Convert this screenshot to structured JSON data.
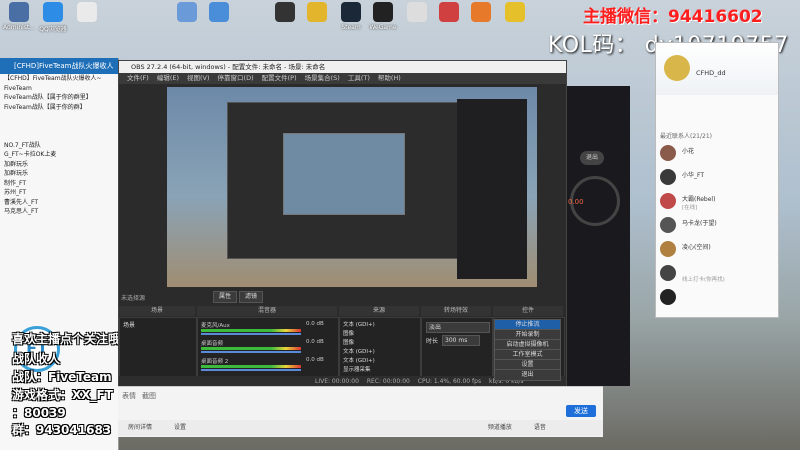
{
  "desktop": {
    "icons": [
      {
        "label": "Administ...",
        "color": "#4a6fa5"
      },
      {
        "label": "QQ浏览器",
        "color": "#2d8ce6"
      },
      {
        "label": "",
        "color": "#eaeaea"
      },
      {
        "label": "",
        "color": "#6a9ad8"
      },
      {
        "label": "",
        "color": "#4a8dd8"
      },
      {
        "label": "",
        "color": "#333333"
      },
      {
        "label": "",
        "color": "#e3b52c"
      },
      {
        "label": "Steam",
        "color": "#1b2838"
      },
      {
        "label": "WeGame",
        "color": "#222222"
      },
      {
        "label": "",
        "color": "#dddddd"
      },
      {
        "label": "",
        "color": "#d04040"
      },
      {
        "label": "",
        "color": "#e67a2a"
      },
      {
        "label": "",
        "color": "#e6c02a"
      }
    ]
  },
  "promo": {
    "wechat_line": "主播微信：94416602",
    "kol_line": "KOL码： dy10719757"
  },
  "chat_window": {
    "title": "[CFHD]FiveTeam战队火爆收人",
    "lines": [
      "【CFHD】FiveTeam战队火爆收人~",
      "FiveTeam",
      "FiveTeam战队【属于你的群里】",
      "FiveTeam战队【属于你的群】",
      "",
      "",
      "",
      "NO.7_FT战队",
      "G_FT~卡拉OK上麦",
      "加群玩乐",
      "加群玩乐",
      "制作_FT",
      "苏州_FT",
      "曹溪先人_FT",
      "马克思人_FT"
    ],
    "overlay": [
      "喜欢主播点个关注哦~",
      "战队收人",
      "战队：FiveTeam",
      "游戏格式：XX_FT",
      "：80039",
      "群：943041683"
    ],
    "logo_text": "FT"
  },
  "obs": {
    "title": "OBS 27.2.4 (64-bit, windows) - 配置文件: 未命名 - 场景: 未命名",
    "menu": [
      "文件(F)",
      "编辑(E)",
      "视图(V)",
      "停靠窗口(D)",
      "配置文件(P)",
      "场景集合(S)",
      "工具(T)",
      "帮助(H)"
    ],
    "preview_caption": "未选择源",
    "attr_btn": "属性",
    "filter_btn": "滤镜",
    "docks": {
      "scenes": "场景",
      "sources": "来源",
      "mixer": "混音器",
      "transitions": "转场特效",
      "controls": "控件"
    },
    "scene_item": "场景",
    "sources_list": [
      "文本 (GDI+)",
      "图像",
      "图像",
      "文本 (GDI+)",
      "文本 (GDI+)",
      "显示器采集"
    ],
    "mixer_tracks": [
      {
        "name": "麦克风/Aux",
        "db": "0.0 dB"
      },
      {
        "name": "桌面音频",
        "db": "0.0 dB"
      },
      {
        "name": "桌面音频 2",
        "db": "0.0 dB"
      }
    ],
    "transition": {
      "type": "淡出",
      "duration_label": "时长",
      "duration": "300 ms"
    },
    "controls": [
      "停止推流",
      "开始录制",
      "启动虚拟摄像机",
      "工作室模式",
      "设置",
      "退出"
    ],
    "status": {
      "live": "LIVE: 00:00:00",
      "rec": "REC: 00:00:00",
      "cpu": "CPU: 1.4%, 60.00 fps",
      "kb": "kb/s: 0 kb/s"
    }
  },
  "client": {
    "button": "退出",
    "stat": "0.00"
  },
  "qq_panel": {
    "header_name": "CFHD_dd",
    "section": "最近联系人(21/21)",
    "contacts": [
      {
        "name": "小花",
        "status": "",
        "color": "#8a5a4a"
      },
      {
        "name": "小华_FT",
        "status": "",
        "color": "#3a3a3a"
      },
      {
        "name": "大霸(Rebel)",
        "status": "[在线]",
        "color": "#c04a4a"
      },
      {
        "name": "马卡龙(于望)",
        "status": "",
        "color": "#555555"
      },
      {
        "name": "凌心(空间)",
        "status": "",
        "color": "#b08040"
      },
      {
        "name": "",
        "status": "线上打卡(你再找)",
        "color": "#444444"
      },
      {
        "name": "",
        "status": "",
        "color": "#222222"
      }
    ]
  },
  "input_bar": {
    "send": "发送",
    "tools": [
      "表情",
      "截图"
    ],
    "footer_left": "房间详情",
    "footer_mid": "设置",
    "footer_right": [
      "频道播放",
      "语音"
    ]
  }
}
